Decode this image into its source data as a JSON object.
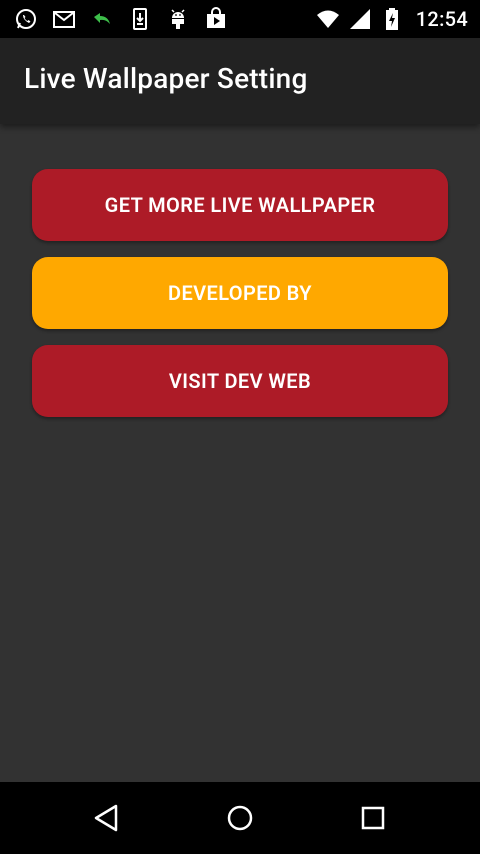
{
  "status_bar": {
    "time": "12:54",
    "left_icons": [
      "whatsapp-icon",
      "gmail-icon",
      "call-forward-icon",
      "download-icon",
      "android-icon",
      "play-store-icon"
    ],
    "right_icons": [
      "wifi-icon",
      "signal-icon",
      "battery-charging-icon"
    ]
  },
  "app_bar": {
    "title": "Live Wallpaper Setting"
  },
  "buttons": [
    {
      "label": "GET MORE LIVE WALLPAPER",
      "color": "#AD1B27"
    },
    {
      "label": "DEVELOPED BY",
      "color": "#FFA800"
    },
    {
      "label": "VISIT DEV WEB",
      "color": "#AD1B27"
    }
  ],
  "nav_bar": {
    "icons": [
      "back-icon",
      "home-icon",
      "recents-icon"
    ]
  },
  "colors": {
    "app_bar_bg": "#222222",
    "content_bg": "#323232",
    "accent_red": "#AD1B27",
    "accent_orange": "#FFA800"
  }
}
